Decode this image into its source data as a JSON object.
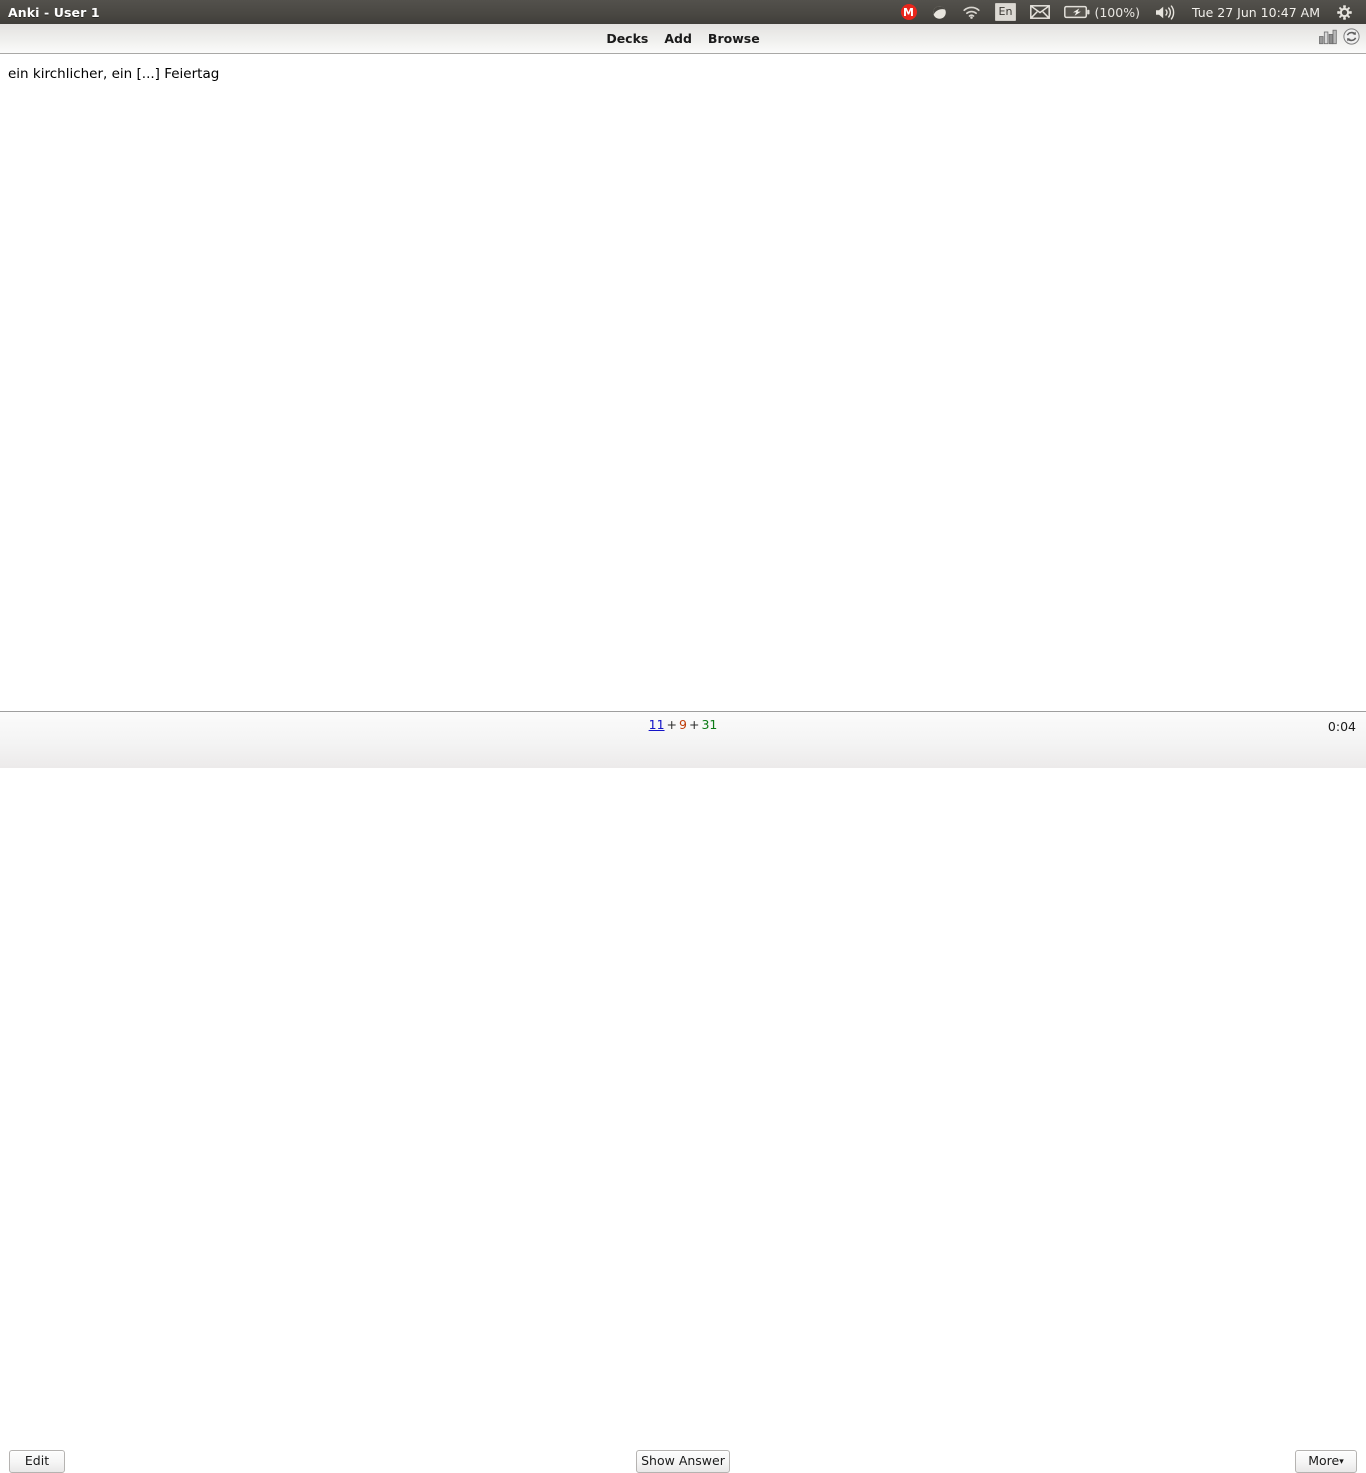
{
  "panel": {
    "window_title": "Anki - User 1",
    "tray": {
      "mail_badge_label": "M",
      "keyboard_layout": "En",
      "battery_label": "(100%)",
      "clock": "Tue 27 Jun 10:47 AM",
      "icons": [
        "mail-badge-icon",
        "spotify-icon",
        "wifi-icon",
        "keyboard-layout-icon",
        "envelope-icon",
        "battery-icon",
        "volume-icon",
        "gear-icon"
      ]
    }
  },
  "toolbar": {
    "menu": [
      {
        "label": "Decks",
        "name": "decks"
      },
      {
        "label": "Add",
        "name": "add"
      },
      {
        "label": "Browse",
        "name": "browse"
      }
    ],
    "icons": [
      {
        "name": "stats-icon",
        "title": "Stats"
      },
      {
        "name": "sync-icon",
        "title": "Sync"
      }
    ]
  },
  "card": {
    "question_text": "ein kirchlicher, ein [...] Feiertag"
  },
  "bottom": {
    "counts": {
      "new": "11",
      "learning": "9",
      "due": "31",
      "separator": "+"
    },
    "timer": "0:04",
    "edit_label": "Edit",
    "show_answer_label": "Show Answer",
    "more_label": "More",
    "more_caret": "▾"
  },
  "colors": {
    "titlebar": "#4a4843",
    "count_new": "#1414c8",
    "count_learning": "#c03d0a",
    "count_due": "#0b7a15",
    "mail_badge": "#e8261c"
  }
}
